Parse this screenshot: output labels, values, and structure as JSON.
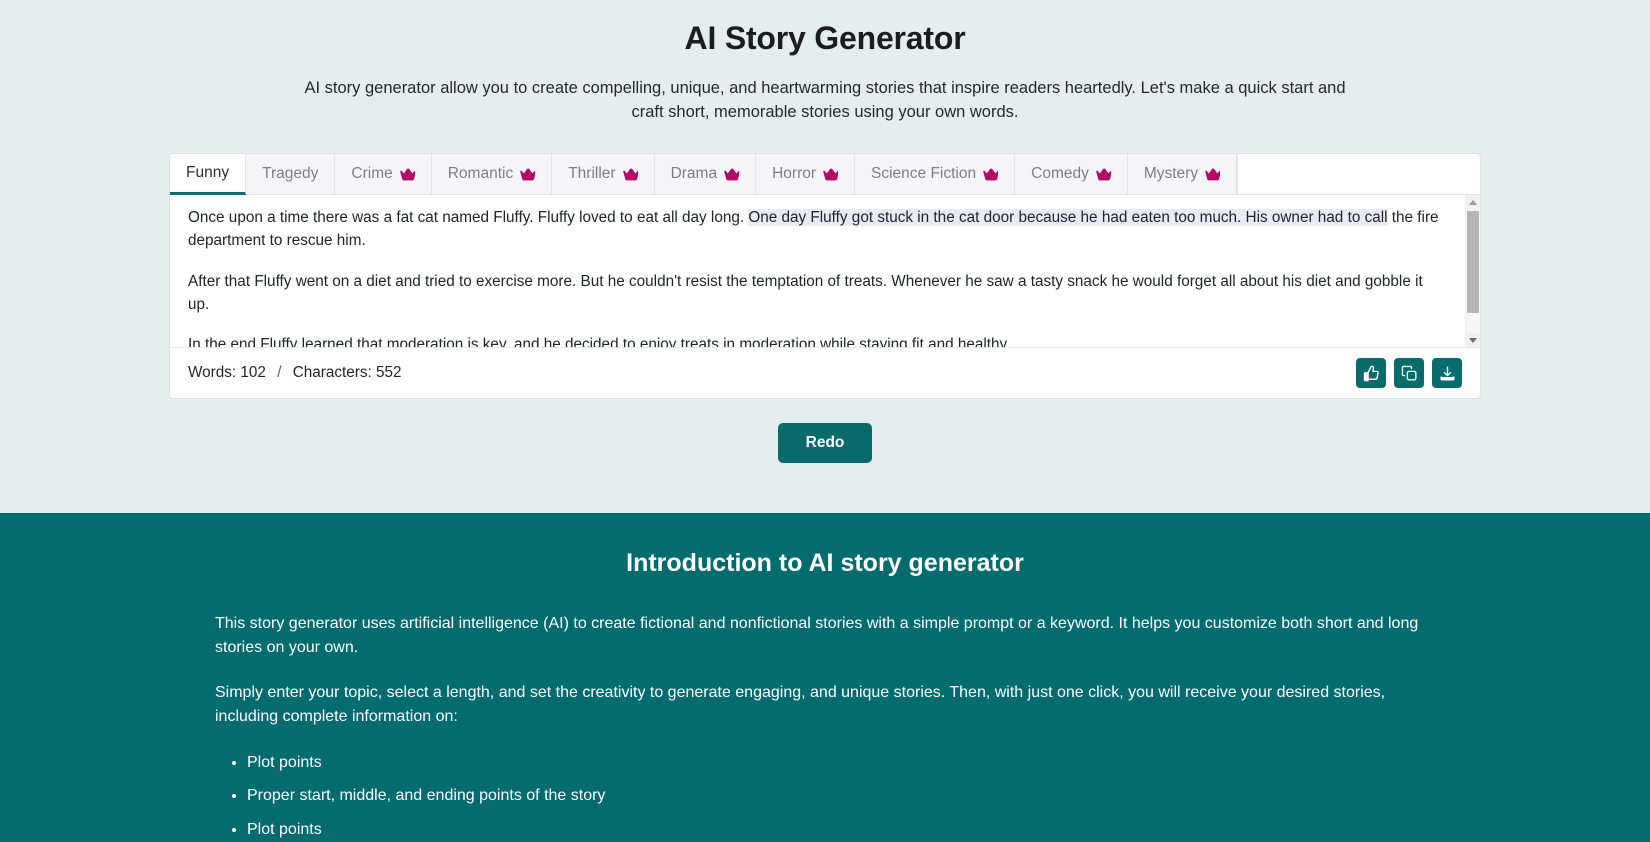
{
  "hero": {
    "title": "AI Story Generator",
    "subtitle": "AI story generator allow you to create compelling, unique, and heartwarming stories that inspire readers heartedly. Let's make a quick start and craft short, memorable stories using your own words."
  },
  "generator": {
    "tabs": [
      {
        "label": "Funny",
        "premium": false,
        "active": true
      },
      {
        "label": "Tragedy",
        "premium": false,
        "active": false
      },
      {
        "label": "Crime",
        "premium": true,
        "active": false
      },
      {
        "label": "Romantic",
        "premium": true,
        "active": false
      },
      {
        "label": "Thriller",
        "premium": true,
        "active": false
      },
      {
        "label": "Drama",
        "premium": true,
        "active": false
      },
      {
        "label": "Horror",
        "premium": true,
        "active": false
      },
      {
        "label": "Science Fiction",
        "premium": true,
        "active": false
      },
      {
        "label": "Comedy",
        "premium": true,
        "active": false
      },
      {
        "label": "Mystery",
        "premium": true,
        "active": false
      }
    ],
    "story": {
      "p1_before": "Once upon a time there was a fat cat named Fluffy. Fluffy loved to eat all day long. ",
      "p1_selected": "One day Fluffy got stuck in the cat door because he had eaten too much. His owner had to call",
      "p1_after": " the fire department to rescue him.",
      "p2": "After that Fluffy went on a diet and tried to exercise more. But he couldn't resist the temptation of treats. Whenever he saw a tasty snack he would forget all about his diet and gobble it up.",
      "p3": "In the end Fluffy learned that moderation is key, and he decided to enjoy treats in moderation while staying fit and healthy."
    },
    "stats": {
      "words_label": "Words:",
      "words_value": "102",
      "separator": "/",
      "chars_label": "Characters:",
      "chars_value": "552"
    },
    "actions": [
      {
        "name": "like",
        "icon": "thumbs-up-icon"
      },
      {
        "name": "copy",
        "icon": "copy-icon"
      },
      {
        "name": "download",
        "icon": "download-icon"
      }
    ],
    "redo_label": "Redo"
  },
  "intro": {
    "title": "Introduction to AI story generator",
    "paragraphs": [
      "This story generator uses artificial intelligence (AI) to create fictional and nonfictional stories with a simple prompt or a keyword. It helps you customize both short and long stories on your own.",
      "Simply enter your topic, select a length, and set the creativity to generate engaging, and unique stories. Then, with just one click, you will receive your desired stories, including complete information on:"
    ],
    "bullets": [
      "Plot points",
      "Proper start, middle, and ending points of the story",
      "Plot points"
    ]
  },
  "colors": {
    "page_bg": "#e4eeee",
    "accent_teal": "#0a6b6d",
    "intro_bg": "#046b6e",
    "crown_magenta": "#b8036b",
    "selection_bg": "#e8eaf4"
  }
}
